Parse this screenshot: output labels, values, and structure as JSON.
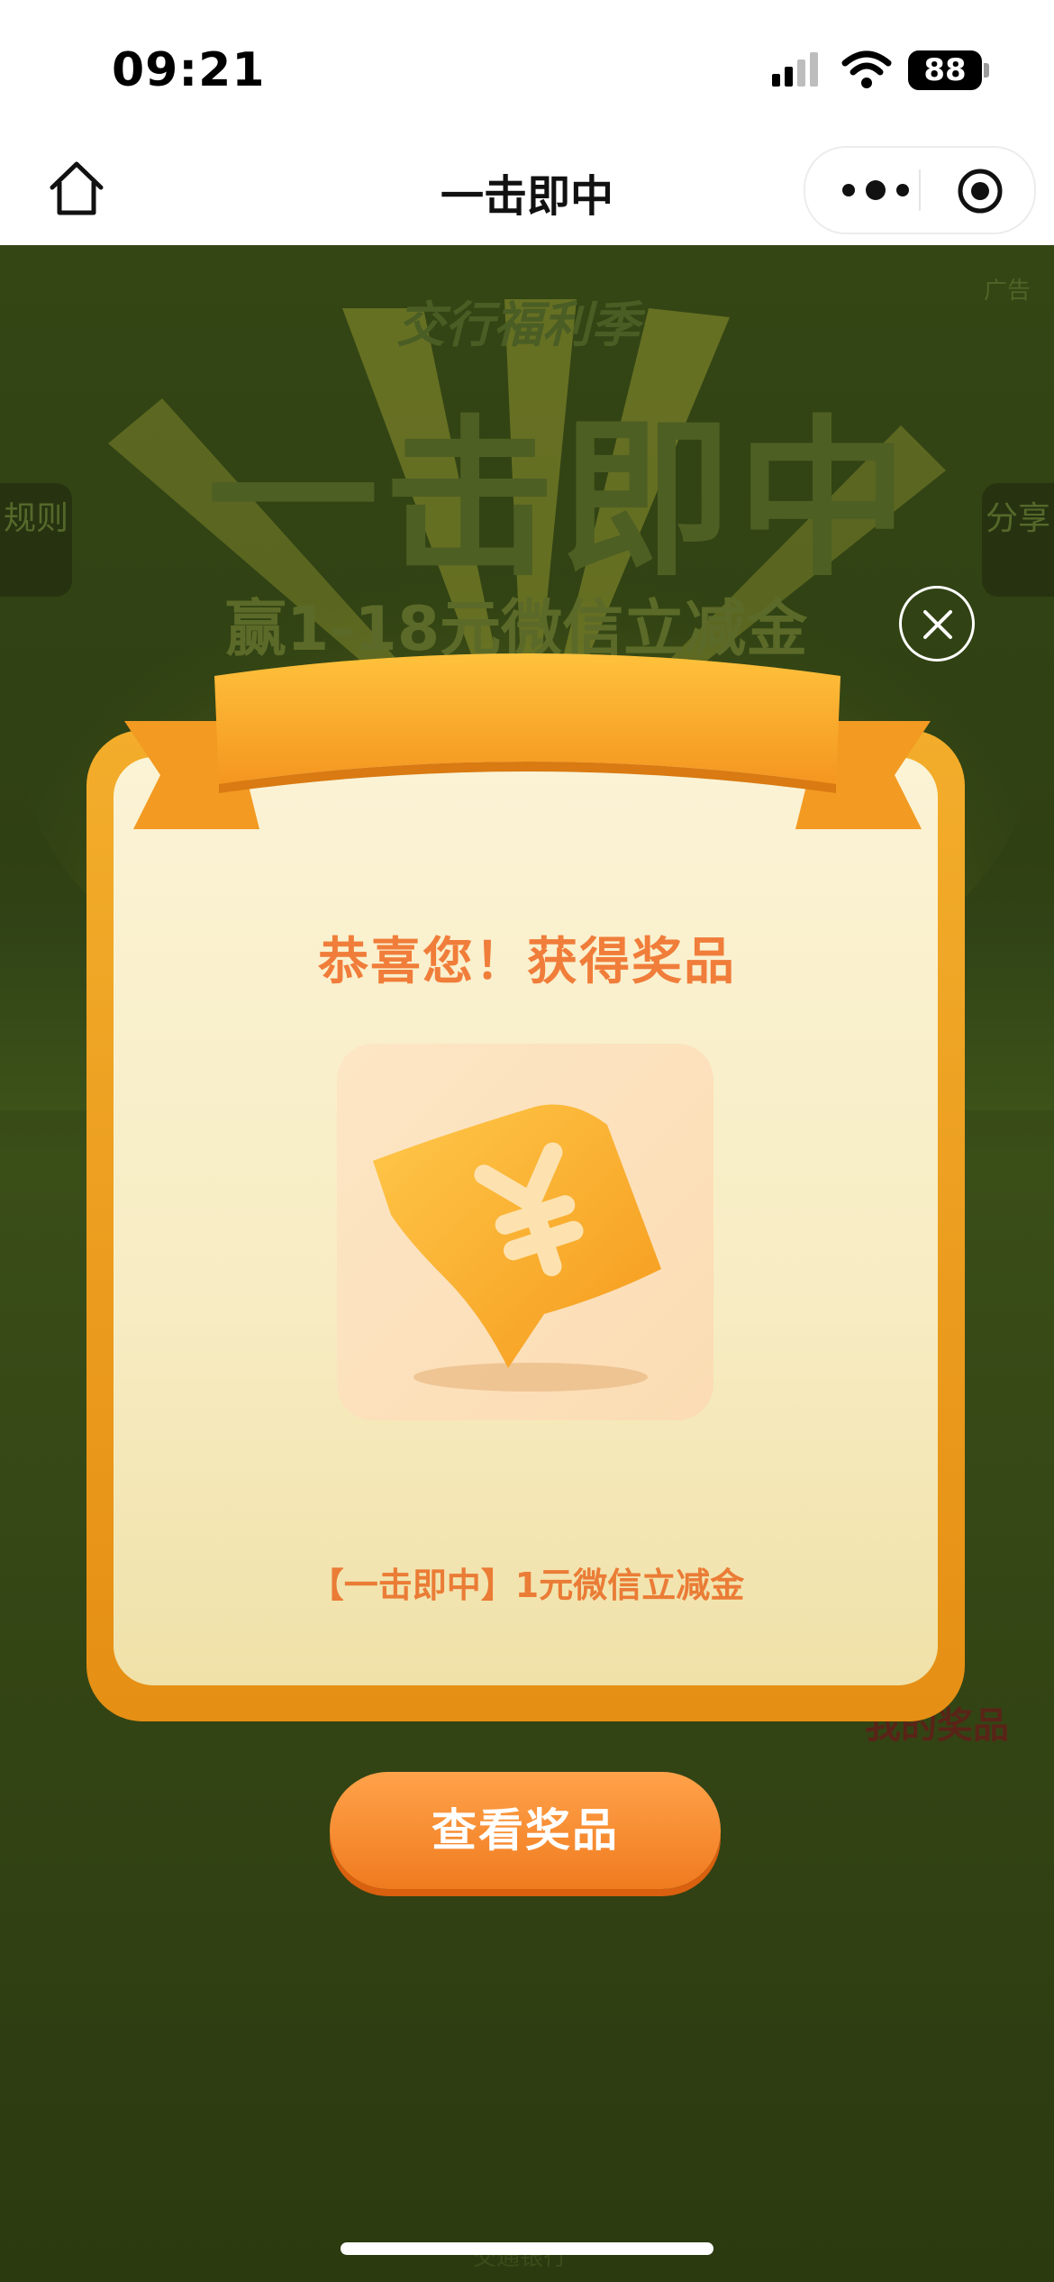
{
  "status_bar": {
    "time": "09:21",
    "battery": "88"
  },
  "nav": {
    "title": "一击即中"
  },
  "background": {
    "ad_tag": "广告",
    "brand": "交行福利季",
    "big_title": "一击即中",
    "subtitle": "赢1-18元微信立减金",
    "rules_tab": "规则",
    "share_tab": "分享",
    "my_prizes": "我的奖品",
    "footer_label": "交通银行"
  },
  "popup": {
    "heading": "恭喜您！获得奖品",
    "prize_icon": "coupon-ticket-icon",
    "prize_name": "【一击即中】1元微信立减金",
    "button_label": "查看奖品"
  },
  "colors": {
    "accent_orange": "#f07b1f",
    "heading_orange": "#f07d3a",
    "card_bg": "#fbf3d5",
    "frame_gold": "#f3ad2b"
  }
}
